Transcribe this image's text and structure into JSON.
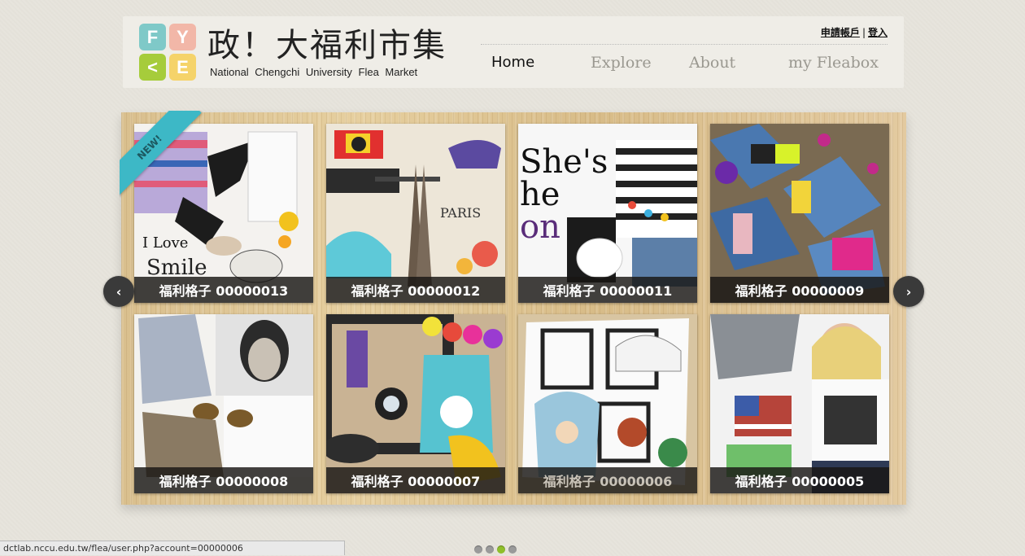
{
  "header": {
    "logo_letters": [
      "F",
      "Y",
      "<",
      "E"
    ],
    "title": "政！大福利市集",
    "subtitle": "National Chengchi University Flea Market",
    "register_link": "申請帳戶",
    "separator": "|",
    "login_link": "登入",
    "nav": [
      {
        "label": "Home",
        "active": true
      },
      {
        "label": "Explore",
        "active": false
      },
      {
        "label": "About",
        "active": false
      },
      {
        "label": "my Fleabox",
        "active": false
      }
    ]
  },
  "badge": {
    "label": "NEW!"
  },
  "items": [
    {
      "caption": "福利格子 00000013"
    },
    {
      "caption": "福利格子 00000012"
    },
    {
      "caption": "福利格子 00000011"
    },
    {
      "caption": "福利格子 00000009"
    },
    {
      "caption": "福利格子 00000008"
    },
    {
      "caption": "福利格子 00000007"
    },
    {
      "caption": "福利格子 00000006"
    },
    {
      "caption": "福利格子 00000005"
    }
  ],
  "carousel": {
    "prev_icon": "‹",
    "next_icon": "›",
    "page_count": 4,
    "active_page": 3
  },
  "status_bar": {
    "url": "dctlab.nccu.edu.tw/flea/user.php?account=00000006"
  },
  "colors": {
    "accent_green": "#8fbf2a",
    "ribbon": "#3db8c6",
    "wood": "#dfc597"
  }
}
